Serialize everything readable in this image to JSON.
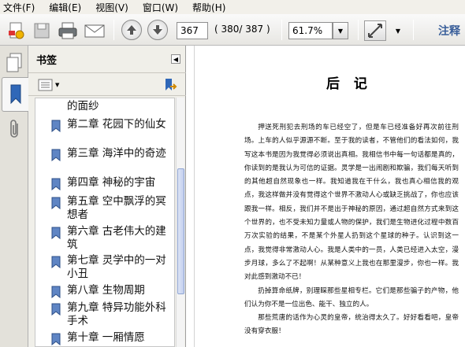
{
  "menu": [
    {
      "label": "文件(F)"
    },
    {
      "label": "编辑(E)"
    },
    {
      "label": "视图(V)"
    },
    {
      "label": "窗口(W)"
    },
    {
      "label": "帮助(H)"
    }
  ],
  "toolbar": {
    "page_current": "367",
    "page_count": "( 380/ 387 )",
    "zoom": "61.7%",
    "comment_label": "注释"
  },
  "bookmarks": {
    "title": "书签",
    "items": [
      {
        "label": "的面纱"
      },
      {
        "label": "第二章 花园下的仙女"
      },
      {
        "label": "第三章 海洋中的奇迹"
      },
      {
        "label": "第四章 神秘的宇宙"
      },
      {
        "label": "第五章 空中飘浮的冥想者"
      },
      {
        "label": "第六章 古老伟大的建筑"
      },
      {
        "label": "第七章 灵学中的一对小丑"
      },
      {
        "label": "第八章 生物周期"
      },
      {
        "label": "第九章 特异功能外科手术"
      },
      {
        "label": "第十章 一厢情愿"
      }
    ]
  },
  "document": {
    "title": "后 记",
    "paragraphs": [
      "押送死刑犯去刑场的车已经空了，但是车已经准备好再次前往刑场。上车的人似乎源源不断。至于我的读者，不管他们的看法如何，我写这本书是因为我觉得必须说出真相。我相信书中每一句话都是真的，你读到的是我认为可信的证据。灵学是一出闹剧和欺骗，我们每天听到的其他超自然现象也一样。我知道我在干什么，我也真心相信我的观点，我这样做并没有觉得这个世界不激动人心或缺乏挑战了，你也应该跟我一样。相反，我们并不是出于神秘的原因，通过超自然方式来到这个世界的，也不受未知力量或人物的保护，我们是生物进化过程中数百万次实验的结果，不是某个外星人扔到这个星球的种子。认识到这一点，我觉得非常激动人心。我是人类中的一员，人类已经进入太空，漫步月球，多么了不起啊！从某种意义上我也在那里漫步，你也一样。我对此感到激动不已！",
      "扔掉算命纸牌，别理睬那些星相专栏。它们是那些骗子的产物，他们认为你不是一位出色、能干、独立的人。",
      "那些荒唐的话作为心灵的皇帝，统治得太久了。好好看看吧，皇帝没有穿衣服！"
    ]
  }
}
